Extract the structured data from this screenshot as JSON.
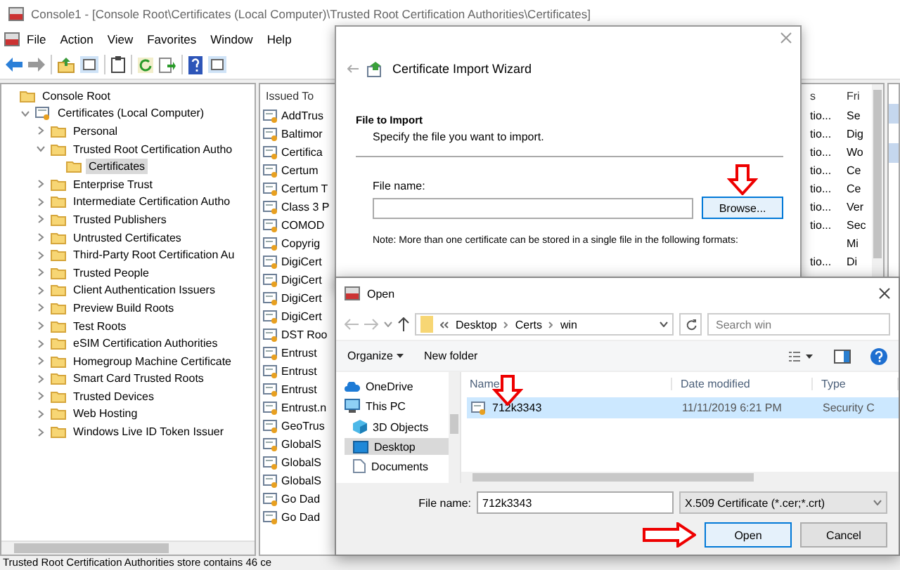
{
  "mmc": {
    "title": "Console1 - [Console Root\\Certificates (Local Computer)\\Trusted Root Certification Authorities\\Certificates]",
    "menu": [
      "File",
      "Action",
      "View",
      "Favorites",
      "Window",
      "Help"
    ],
    "tree": [
      {
        "label": "Console Root",
        "selected": false,
        "children": [
          {
            "label": "Certificates (Local Computer)",
            "kind": "store",
            "selected": false,
            "expanded": true,
            "children": [
              {
                "label": "Personal",
                "selected": false,
                "expanded": false
              },
              {
                "label": "Trusted Root Certification Autho",
                "selected": false,
                "expanded": true,
                "children": [
                  {
                    "label": "Certificates",
                    "selected": true
                  }
                ]
              },
              {
                "label": "Enterprise Trust",
                "selected": false,
                "expanded": false
              },
              {
                "label": "Intermediate Certification Autho",
                "selected": false,
                "expanded": false
              },
              {
                "label": "Trusted Publishers",
                "selected": false,
                "expanded": false
              },
              {
                "label": "Untrusted Certificates",
                "selected": false,
                "expanded": false
              },
              {
                "label": "Third-Party Root Certification Au",
                "selected": false,
                "expanded": false
              },
              {
                "label": "Trusted People",
                "selected": false,
                "expanded": false
              },
              {
                "label": "Client Authentication Issuers",
                "selected": false,
                "expanded": false
              },
              {
                "label": "Preview Build Roots",
                "selected": false,
                "expanded": false
              },
              {
                "label": "Test Roots",
                "selected": false,
                "expanded": false
              },
              {
                "label": "eSIM Certification Authorities",
                "selected": false,
                "expanded": false
              },
              {
                "label": "Homegroup Machine Certificate",
                "selected": false,
                "expanded": false
              },
              {
                "label": "Smart Card Trusted Roots",
                "selected": false,
                "expanded": false
              },
              {
                "label": "Trusted Devices",
                "selected": false,
                "expanded": false
              },
              {
                "label": "Web Hosting",
                "selected": false,
                "expanded": false
              },
              {
                "label": "Windows Live ID Token Issuer",
                "selected": false,
                "expanded": false
              }
            ]
          }
        ]
      }
    ],
    "list": {
      "columns": [
        "Issued To",
        "s",
        "Fri"
      ],
      "rows": [
        {
          "issued_to": "AddTrus",
          "column_2": "tio...",
          "column_3": "Se"
        },
        {
          "issued_to": "Baltimor",
          "column_2": "tio...",
          "column_3": "Dig"
        },
        {
          "issued_to": "Certifica",
          "column_2": "tio...",
          "column_3": "Wo"
        },
        {
          "issued_to": "Certum",
          "column_2": "tio...",
          "column_3": "Ce"
        },
        {
          "issued_to": "Certum T",
          "column_2": "tio...",
          "column_3": "Ce"
        },
        {
          "issued_to": "Class 3 P",
          "column_2": "tio...",
          "column_3": "Ver"
        },
        {
          "issued_to": "COMOD",
          "column_2": "tio...",
          "column_3": "Sec"
        },
        {
          "issued_to": "Copyrig",
          "column_3": "Mi"
        },
        {
          "issued_to": "DigiCert",
          "column_2": "tio...",
          "column_3": "Di"
        },
        {
          "issued_to": "DigiCert"
        },
        {
          "issued_to": "DigiCert"
        },
        {
          "issued_to": "DigiCert"
        },
        {
          "issued_to": "DST Roo"
        },
        {
          "issued_to": "Entrust"
        },
        {
          "issued_to": "Entrust"
        },
        {
          "issued_to": "Entrust"
        },
        {
          "issued_to": "Entrust.n"
        },
        {
          "issued_to": "GeoTrus"
        },
        {
          "issued_to": "GlobalS"
        },
        {
          "issued_to": "GlobalS"
        },
        {
          "issued_to": "GlobalS"
        },
        {
          "issued_to": "Go Dad"
        },
        {
          "issued_to": "Go Dad"
        }
      ]
    },
    "status_bar": "Trusted Root Certification Authorities store contains 46 ce"
  },
  "wizard": {
    "title": "Certificate Import Wizard",
    "heading": "File to Import",
    "subtitle": "Specify the file you want to import.",
    "field_label": "File name:",
    "browse_button": "Browse...",
    "note": "Note:  More than one certificate can be stored in a single file in the following formats:"
  },
  "open_dialog": {
    "title": "Open",
    "breadcrumb": [
      "Desktop",
      "Certs",
      "win"
    ],
    "search": {
      "placeholder": "Search win"
    },
    "toolbar": [
      "Organize",
      "New folder"
    ],
    "nav": [
      {
        "label": "OneDrive",
        "kind": "cloud",
        "selected": false
      },
      {
        "label": "This PC",
        "kind": "pc",
        "selected": false,
        "children": [
          {
            "label": "3D Objects",
            "kind": "cube",
            "selected": false
          },
          {
            "label": "Desktop",
            "kind": "desktop",
            "selected": true
          },
          {
            "label": "Documents",
            "kind": "document",
            "selected": false
          }
        ]
      }
    ],
    "files": {
      "columns": [
        "Name",
        "Date modified",
        "Type"
      ],
      "rows": [
        {
          "name": "712k3343",
          "date_modified": "11/11/2019 6:21 PM",
          "type": "Security C",
          "selected": true
        }
      ]
    },
    "file_name_label": "File name:",
    "file_name": "712k3343",
    "file_type": "X.509 Certificate (*.cer;*.crt)",
    "buttons": [
      {
        "label": "Open",
        "default": true
      },
      {
        "label": "Cancel",
        "default": false
      }
    ]
  }
}
